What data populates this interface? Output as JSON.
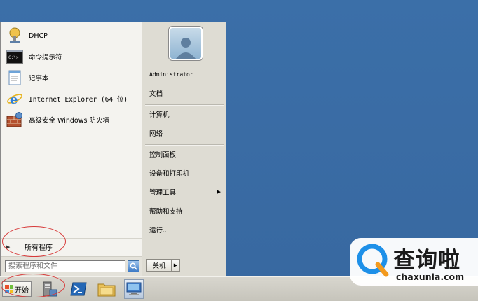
{
  "start_menu": {
    "programs": [
      {
        "label": "DHCP",
        "icon": "dhcp-icon"
      },
      {
        "label": "命令提示符",
        "icon": "command-prompt-icon"
      },
      {
        "label": "记事本",
        "icon": "notepad-icon"
      },
      {
        "label": "Internet Explorer (64 位)",
        "icon": "internet-explorer-icon"
      },
      {
        "label": "高级安全 Windows 防火墙",
        "icon": "firewall-icon"
      }
    ],
    "all_programs": "所有程序",
    "search_placeholder": "搜索程序和文件",
    "right_items": {
      "user": "Administrator",
      "documents": "文档",
      "computer": "计算机",
      "network": "网络",
      "control_panel": "控制面板",
      "devices_printers": "设备和打印机",
      "admin_tools": "管理工具",
      "help": "帮助和支持",
      "run": "运行..."
    },
    "shutdown": "关机"
  },
  "taskbar": {
    "start": "开始"
  },
  "watermark": {
    "cn": "查询啦",
    "en": "chaxunla.com"
  },
  "colors": {
    "desktop": "#3a6ea5",
    "annotation": "#d73a3a",
    "watermark_accent": "#1e90e8"
  }
}
